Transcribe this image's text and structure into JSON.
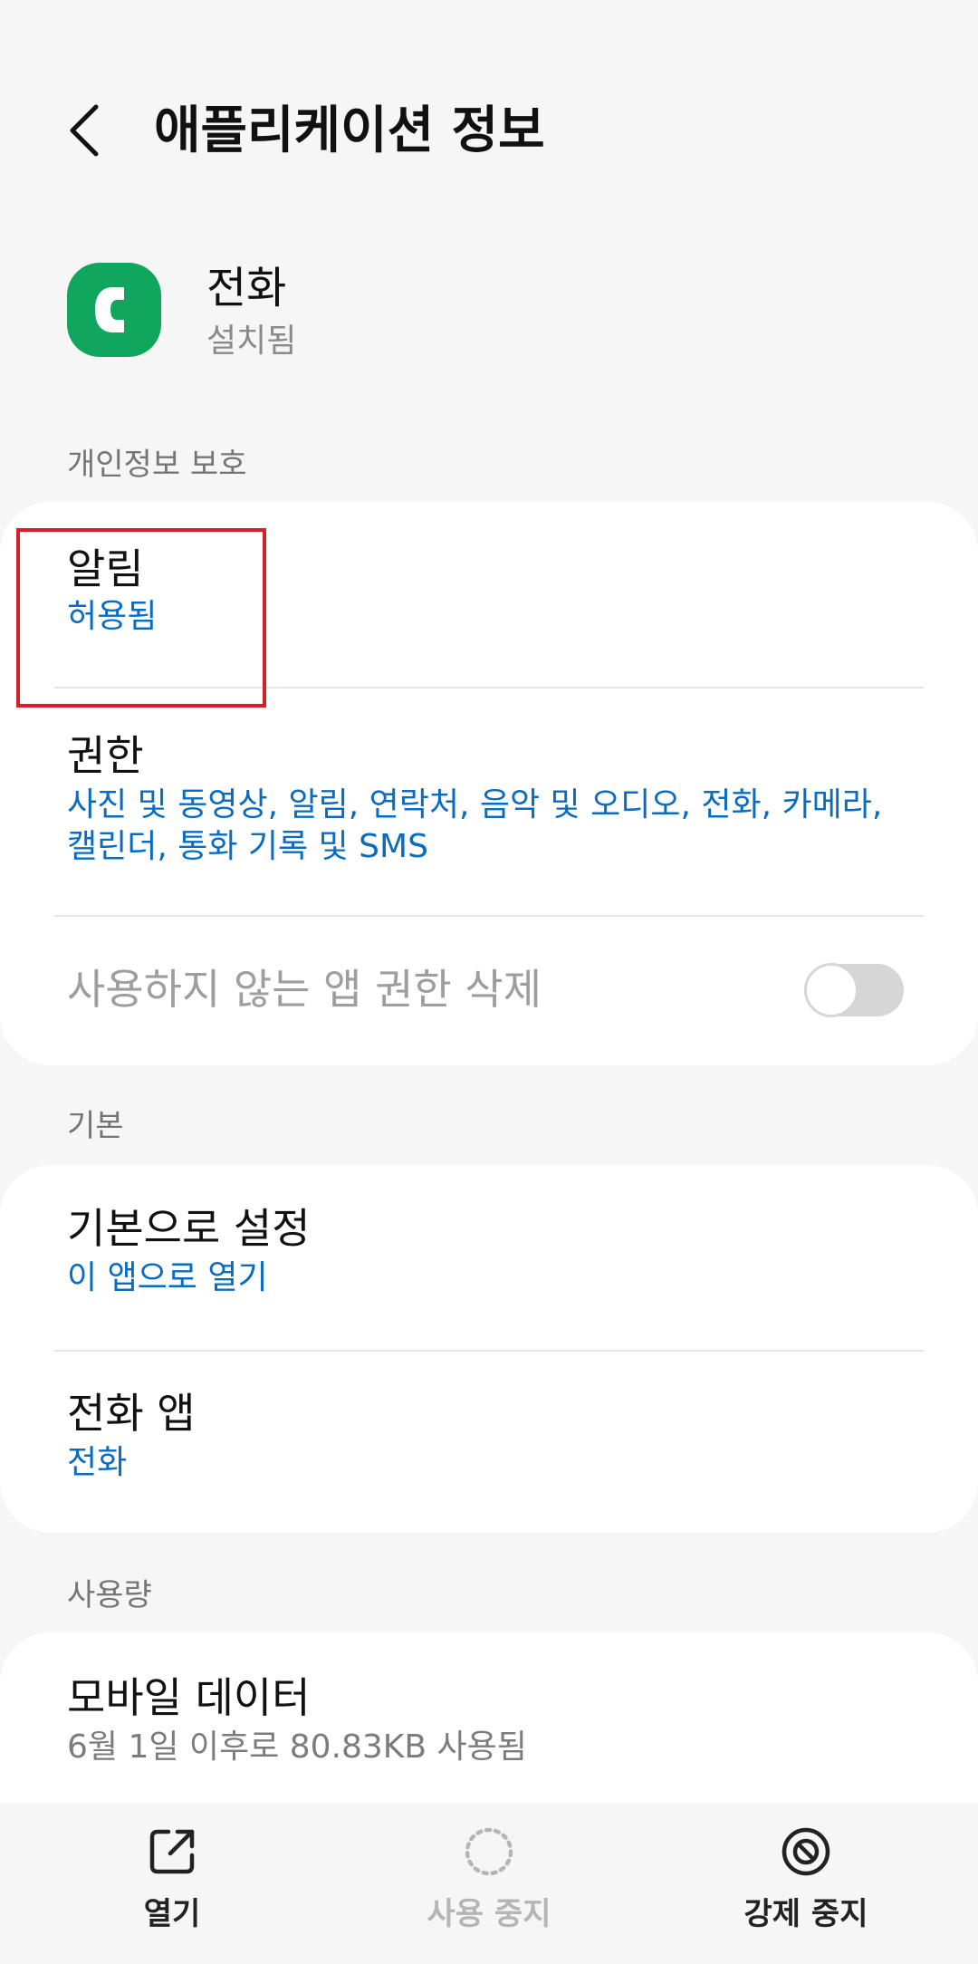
{
  "header": {
    "title": "애플리케이션 정보",
    "back_icon": "chevron-left-icon"
  },
  "app": {
    "name": "전화",
    "status": "설치됨",
    "icon": "phone-app-icon",
    "icon_color": "#10a65e"
  },
  "sections": {
    "privacy": "개인정보 보호",
    "basic": "기본",
    "usage": "사용량"
  },
  "privacy": {
    "notifications": {
      "title": "알림",
      "value": "허용됨"
    },
    "permissions": {
      "title": "권한",
      "value_line1": "사진 및 동영상, 알림, 연락처, 음악 및 오디오, 전화, 카메라,",
      "value_line2": "캘린더, 통화 기록 및 SMS"
    },
    "remove_unused": {
      "title": "사용하지 않는 앱 권한 삭제",
      "enabled": false
    }
  },
  "basic": {
    "set_default": {
      "title": "기본으로 설정",
      "value": "이 앱으로 열기"
    },
    "phone_app": {
      "title": "전화 앱",
      "value": "전화"
    }
  },
  "usage": {
    "mobile_data": {
      "title": "모바일 데이터",
      "value": "6월 1일 이후로 80.83KB 사용됨"
    }
  },
  "bottom_bar": {
    "open": {
      "label": "열기",
      "icon": "open-external-icon"
    },
    "disable": {
      "label": "사용 중지",
      "icon": "dotted-circle-icon",
      "enabled": false
    },
    "force_stop": {
      "label": "강제 중지",
      "icon": "block-icon"
    }
  },
  "colors": {
    "accent": "#0a6cc1",
    "background": "#f6f6f6",
    "highlight": "#d81f26"
  }
}
